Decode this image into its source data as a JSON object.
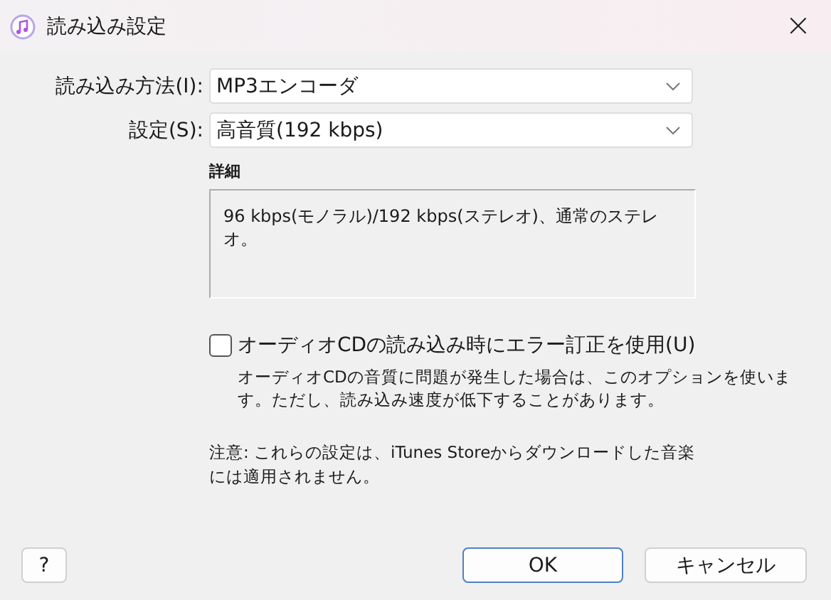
{
  "window": {
    "title": "読み込み設定",
    "close": "×"
  },
  "fields": [
    {
      "label": "読み込み方法(I):",
      "value": "MP3エンコーダ"
    },
    {
      "label": "設定(S):",
      "value": "高音質(192 kbps)"
    }
  ],
  "details": {
    "heading": "詳細",
    "text": "96 kbps(モノラル)/192 kbps(ステレオ)、通常のステレオ。"
  },
  "error_correction": {
    "label": "オーディオCDの読み込み時にエラー訂正を使用(U)",
    "checked": false,
    "description": "オーディオCDの音質に問題が発生した場合は、このオプションを使います。ただし、読み込み速度が低下することがあります。"
  },
  "note": "注意: これらの設定は、iTunes Storeからダウンロードした音楽には適用されません。",
  "buttons": {
    "help": "?",
    "ok": "OK",
    "cancel": "キャンセル"
  }
}
